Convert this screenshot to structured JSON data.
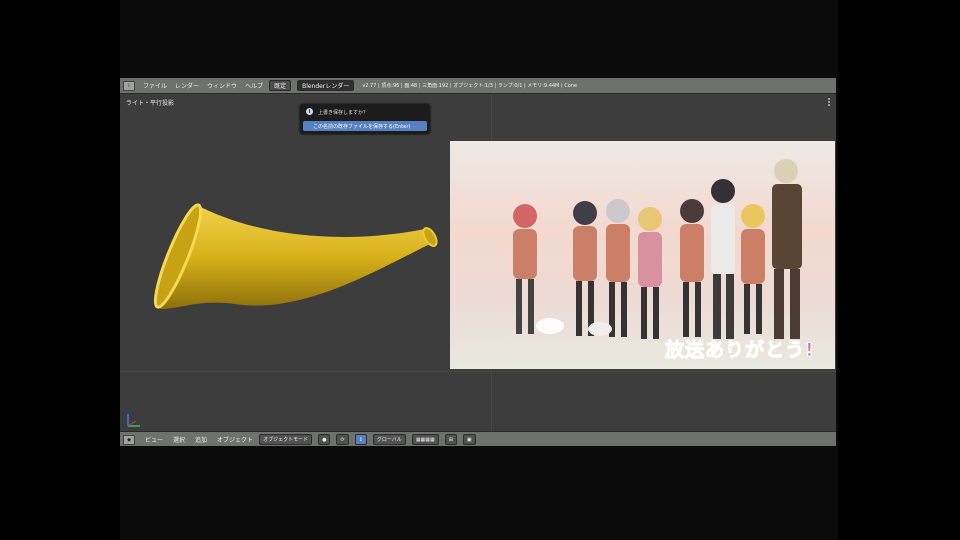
{
  "topbar": {
    "menus": [
      "ファイル",
      "レンダー",
      "ウィンドウ",
      "ヘルプ"
    ],
    "layout_label": "既定",
    "engine_label": "Blenderレンダー",
    "stats": "v2.77 | 頂点:96 | 面:48 | 三角面:192 | オブジェクト:1/3 | ランプ:0/1 | メモリ:9.44M | Cone"
  },
  "viewport": {
    "label": "ライト・平行投影",
    "popup": {
      "title": "上書き保存しますか？",
      "item": "この名前の既存ファイルを保存する(Enter)"
    },
    "caption": "放送ありがとう!"
  },
  "bottombar": {
    "menus": [
      "ビュー",
      "選択",
      "追加",
      "オブジェクト"
    ],
    "mode": "オブジェクトモード",
    "orientation": "グローバル"
  },
  "colors": {
    "horn": "#d8b21c",
    "highlight": "#5680c2",
    "caption": "#e86cb0"
  }
}
